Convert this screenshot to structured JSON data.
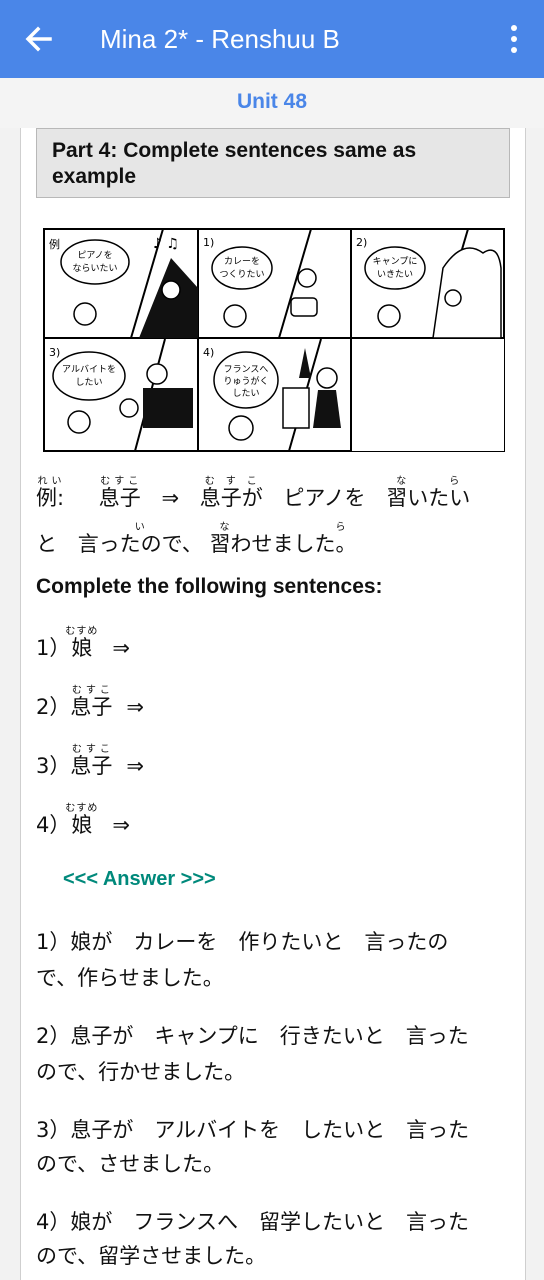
{
  "appbar": {
    "title": "Mina 2* - Renshuu B"
  },
  "unit": {
    "label": "Unit 48"
  },
  "part": {
    "title": "Part 4: Complete sentences same as example"
  },
  "illustration": {
    "example_mark": "例",
    "panels": [
      {
        "num": "1)",
        "bubble": [
          "カレーを",
          "つくりたい"
        ]
      },
      {
        "num": "2)",
        "bubble": [
          "キャンプに",
          "いきたい"
        ]
      },
      {
        "num": "3)",
        "bubble": [
          "アルバイトを",
          "したい"
        ]
      },
      {
        "num": "4)",
        "bubble": [
          "フランスへ",
          "りゅうがく",
          "したい"
        ]
      }
    ],
    "example_bubble": [
      "ピアノを",
      "ならいたい"
    ]
  },
  "example": {
    "label": "例:",
    "arrow": "⇒",
    "subject": "息子",
    "subject_ga": "息子が",
    "object": "ピアノを",
    "verb": "習いたい",
    "line2": [
      "と",
      "言ったので、",
      "習わせました。"
    ]
  },
  "instructions": "Complete the following sentences:",
  "questions": [
    {
      "num": "1）",
      "subject": "娘",
      "arrow": "⇒"
    },
    {
      "num": "2）",
      "subject": "息子",
      "arrow": "⇒"
    },
    {
      "num": "3）",
      "subject": "息子",
      "arrow": "⇒"
    },
    {
      "num": "4）",
      "subject": "娘",
      "arrow": "⇒"
    }
  ],
  "answer_link": "<<< Answer >>>",
  "answers": [
    {
      "num": "1）",
      "l1": "娘が　カレーを　作りたいと　言ったの",
      "l2": "で、作らせました。"
    },
    {
      "num": "2）",
      "l1": "息子が　キャンプに　行きたいと　言った",
      "l2": "ので、行かせました。"
    },
    {
      "num": "3）",
      "l1": "息子が　アルバイトを　したいと　言った",
      "l2": "ので、させました。"
    },
    {
      "num": "4）",
      "l1": "娘が　フランスへ　留学したいと　言った",
      "l2": "ので、留学させました。"
    }
  ],
  "colors": {
    "appbar": "#4a86e8",
    "unit": "#4a86e8",
    "answer": "#00897b"
  }
}
